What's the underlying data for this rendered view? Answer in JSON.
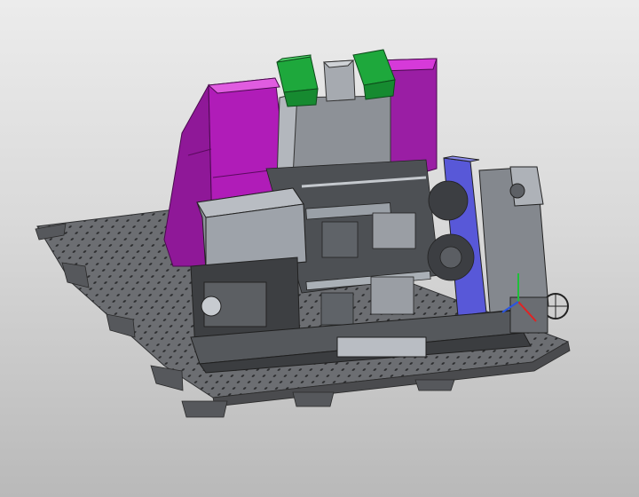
{
  "viewport": {
    "kind": "3D CAD model viewport",
    "background": {
      "top": "#ececec",
      "bottom": "#b9b9b9"
    }
  },
  "model": {
    "colors": {
      "enclosure": "#b01cb8",
      "enclosure_light": "#d63ad9",
      "top_units": "#1ea83c",
      "side_plate": "#5858d8",
      "frame_gray": "#8e939b",
      "frame_dark": "#3d3f42",
      "base_plate": "#6f7175"
    }
  },
  "triad": {
    "axes": [
      {
        "name": "Y",
        "color": "#1fbf3a"
      },
      {
        "name": "X",
        "color": "#e22222"
      },
      {
        "name": "Z",
        "color": "#2a55e0"
      }
    ]
  }
}
